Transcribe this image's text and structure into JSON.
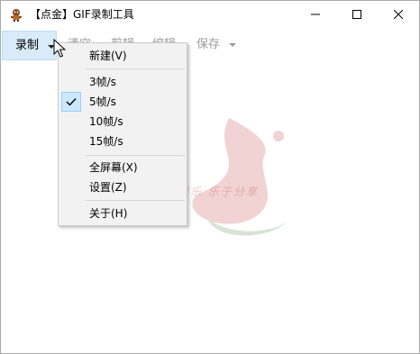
{
  "window": {
    "title": "【点金】GIF录制工具",
    "controls": {
      "minimize": "minimize",
      "maximize": "maximize",
      "close": "close"
    }
  },
  "toolbar": {
    "record_label": "录制",
    "items": [
      {
        "label": "清空"
      },
      {
        "label": "剪辑"
      },
      {
        "label": "编辑"
      },
      {
        "label": "保存"
      }
    ]
  },
  "record_menu": {
    "items": [
      {
        "label": "新建(V)",
        "checked": false
      },
      {
        "label": "3帧/s",
        "checked": false
      },
      {
        "label": "5帧/s",
        "checked": true
      },
      {
        "label": "10帧/s",
        "checked": false
      },
      {
        "label": "15帧/s",
        "checked": false
      },
      {
        "label": "全屏幕(X)",
        "checked": false
      },
      {
        "label": "设置(Z)",
        "checked": false
      },
      {
        "label": "关于(H)",
        "checked": false
      }
    ]
  },
  "watermark": {
    "text": "小刀娱乐 乐于分享"
  },
  "colors": {
    "accent": "#cce8ff",
    "record_button_bg": "#d9ebf9",
    "disabled_text": "#9a9a9a",
    "menu_bg": "#f2f2f2",
    "watermark": "#c23a3a"
  }
}
